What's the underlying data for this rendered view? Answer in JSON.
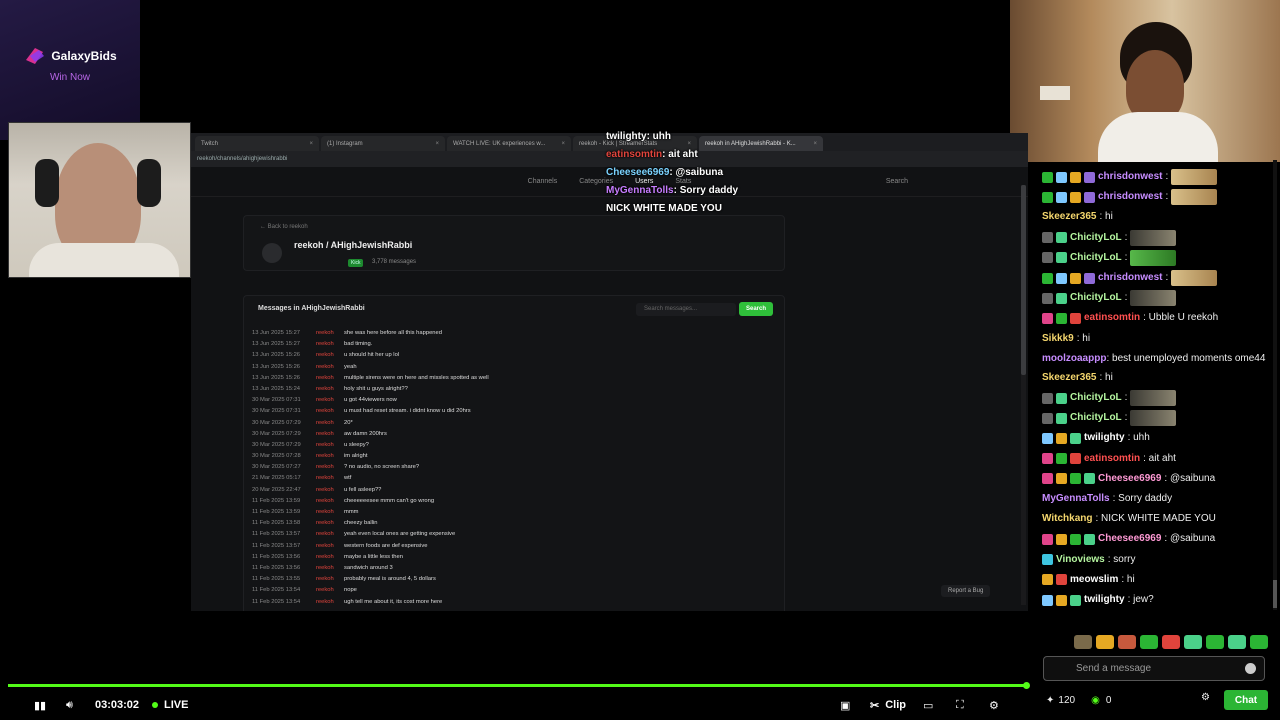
{
  "sponsor": {
    "name": "GalaxyBids",
    "tagline": "Win Now"
  },
  "browser": {
    "tabs": [
      {
        "label": "Twitch"
      },
      {
        "label": "(1) Instagram"
      },
      {
        "label": "WATCH LIVE: UK experiences w..."
      },
      {
        "label": "reekoh - Kick | StreamerStats"
      },
      {
        "label": "reekoh in AHighJewishRabbi - K..."
      }
    ],
    "url": "reekoh/channels/ahighjewishrabbi",
    "nav": [
      "Channels",
      "Categories",
      "Users",
      "Stats"
    ],
    "nav_search": "Search",
    "back_link": "← Back to reekoh",
    "profile": {
      "name": "reekoh  /  AHighJewishRabbi",
      "platform": "Kick",
      "messages": "3,778 messages",
      "view_channel": "View channel"
    },
    "panel_title": "Messages in AHighJewishRabbi",
    "search_placeholder": "Search messages...",
    "search_button": "Search",
    "messages": [
      {
        "date": "13 Jun 2025 15:27",
        "user": "reekoh",
        "text": "she was here before all this happened"
      },
      {
        "date": "13 Jun 2025 15:27",
        "user": "reekoh",
        "text": "bad timing."
      },
      {
        "date": "13 Jun 2025 15:26",
        "user": "reekoh",
        "text": "u should hit her up lol"
      },
      {
        "date": "13 Jun 2025 15:26",
        "user": "reekoh",
        "text": "yeah"
      },
      {
        "date": "13 Jun 2025 15:26",
        "user": "reekoh",
        "text": "multiple sirens were on here and missles spotted as well"
      },
      {
        "date": "13 Jun 2025 15:24",
        "user": "reekoh",
        "text": "holy shit u guys alright??"
      },
      {
        "date": "30 Mar 2025 07:31",
        "user": "reekoh",
        "text": "u got 44viewers now"
      },
      {
        "date": "30 Mar 2025 07:31",
        "user": "reekoh",
        "text": "u must had reset stream. i didnt know u did 20hrs"
      },
      {
        "date": "30 Mar 2025 07:29",
        "user": "reekoh",
        "text": "20*"
      },
      {
        "date": "30 Mar 2025 07:29",
        "user": "reekoh",
        "text": "aw damn 200hrs"
      },
      {
        "date": "30 Mar 2025 07:29",
        "user": "reekoh",
        "text": "u sleepy?"
      },
      {
        "date": "30 Mar 2025 07:28",
        "user": "reekoh",
        "text": "im alright"
      },
      {
        "date": "30 Mar 2025 07:27",
        "user": "reekoh",
        "text": "? no audio, no screen share?"
      },
      {
        "date": "21 Mar 2025 05:17",
        "user": "reekoh",
        "text": "wtf"
      },
      {
        "date": "20 Mar 2025 22:47",
        "user": "reekoh",
        "text": "u fell asleep??"
      },
      {
        "date": "11 Feb 2025 13:59",
        "user": "reekoh",
        "text": "cheeeeeesee mmm can't go wrong"
      },
      {
        "date": "11 Feb 2025 13:59",
        "user": "reekoh",
        "text": "mmm"
      },
      {
        "date": "11 Feb 2025 13:58",
        "user": "reekoh",
        "text": "cheezy ballin"
      },
      {
        "date": "11 Feb 2025 13:57",
        "user": "reekoh",
        "text": "yeah even local ones are getting expensive"
      },
      {
        "date": "11 Feb 2025 13:57",
        "user": "reekoh",
        "text": "western foods are def expensive"
      },
      {
        "date": "11 Feb 2025 13:56",
        "user": "reekoh",
        "text": "maybe a little less then"
      },
      {
        "date": "11 Feb 2025 13:56",
        "user": "reekoh",
        "text": "sandwich around 3"
      },
      {
        "date": "11 Feb 2025 13:55",
        "user": "reekoh",
        "text": "probably meal is around 4, 5 dollars"
      },
      {
        "date": "11 Feb 2025 13:54",
        "user": "reekoh",
        "text": "nope"
      },
      {
        "date": "11 Feb 2025 13:54",
        "user": "reekoh",
        "text": "ugh tell me about it, its cost more here"
      }
    ],
    "report_bug": "Report a Bug"
  },
  "alert": [
    {
      "user": "twilighty",
      "text": ": uhh",
      "color": "#ffffff"
    },
    {
      "user": "eatinsomtin",
      "text": ": ait aht",
      "color": "#e0443c"
    },
    {
      "user": "Cheesee6969",
      "text": ": @saibuna",
      "color": "#7bd3ff"
    },
    {
      "user": "MyGennaTolls",
      "text": ": Sorry daddy",
      "color": "#c77dff"
    },
    {
      "user": "",
      "text": "NICK WHITE MADE YOU",
      "color": "#ffffff"
    }
  ],
  "chat": [
    {
      "badges": [
        "#2bb534",
        "#7ec8ff",
        "#e5a823",
        "#8f6ad8"
      ],
      "user": "chrisdonwest",
      "color": "#c78dff",
      "text": ":",
      "emote": "doll"
    },
    {
      "badges": [
        "#2bb534",
        "#7ec8ff",
        "#e5a823",
        "#8f6ad8"
      ],
      "user": "chrisdonwest",
      "color": "#c78dff",
      "text": ":",
      "emote": "doll"
    },
    {
      "badges": [],
      "user": "Skeezer365",
      "color": "#f5d76e",
      "text": ": hi",
      "emote": ""
    },
    {
      "badges": [
        "#666666",
        "#4bd18a"
      ],
      "user": "ChicityLoL",
      "color": "#b5f5a0",
      "text": ":",
      "emote": "wide"
    },
    {
      "badges": [
        "#666666",
        "#4bd18a"
      ],
      "user": "ChicityLoL",
      "color": "#b5f5a0",
      "text": ":",
      "emote": "small"
    },
    {
      "badges": [
        "#2bb534",
        "#7ec8ff",
        "#e5a823",
        "#8f6ad8"
      ],
      "user": "chrisdonwest",
      "color": "#c78dff",
      "text": ":",
      "emote": "doll"
    },
    {
      "badges": [
        "#666666",
        "#4bd18a"
      ],
      "user": "ChicityLoL",
      "color": "#b5f5a0",
      "text": ":",
      "emote": "wide"
    },
    {
      "badges": [
        "#e0448a",
        "#2bb534",
        "#e0443c"
      ],
      "user": "eatinsomtin",
      "color": "#ff5050",
      "text": ": Ubble U reekoh",
      "emote": ""
    },
    {
      "badges": [],
      "user": "Sikkk9",
      "color": "#f5d76e",
      "text": ": hi",
      "emote": ""
    },
    {
      "badges": [],
      "user": "moolzoaappp",
      "color": "#c78dff",
      "text": ": best unemployed moments ome44",
      "emote": "",
      "wrap": true
    },
    {
      "badges": [],
      "user": "Skeezer365",
      "color": "#f5d76e",
      "text": ": hi",
      "emote": ""
    },
    {
      "badges": [
        "#666666",
        "#4bd18a"
      ],
      "user": "ChicityLoL",
      "color": "#b5f5a0",
      "text": ":",
      "emote": "wide"
    },
    {
      "badges": [
        "#666666",
        "#4bd18a"
      ],
      "user": "ChicityLoL",
      "color": "#b5f5a0",
      "text": ":",
      "emote": "wide"
    },
    {
      "badges": [
        "#7ec8ff",
        "#e5a823",
        "#4bd18a"
      ],
      "user": "twilighty",
      "color": "#ffffff",
      "text": ": uhh",
      "emote": ""
    },
    {
      "badges": [
        "#e0448a",
        "#2bb534",
        "#e0443c"
      ],
      "user": "eatinsomtin",
      "color": "#ff5050",
      "text": ": ait aht",
      "emote": ""
    },
    {
      "badges": [
        "#e0448a",
        "#e5a823",
        "#2bb534",
        "#4bd18a"
      ],
      "user": "Cheesee6969",
      "color": "#ff9ad5",
      "text": ": @saibuna",
      "emote": ""
    },
    {
      "badges": [],
      "user": "MyGennaTolls",
      "color": "#c78dff",
      "text": ": Sorry daddy",
      "emote": ""
    },
    {
      "badges": [],
      "user": "Witchkang",
      "color": "#f5d76e",
      "text": ": NICK WHITE MADE YOU",
      "emote": ""
    },
    {
      "badges": [
        "#e0448a",
        "#e5a823",
        "#2bb534",
        "#4bd18a"
      ],
      "user": "Cheesee6969",
      "color": "#ff9ad5",
      "text": ": @saibuna",
      "emote": ""
    },
    {
      "badges": [
        "#3ec5e0"
      ],
      "user": "Vinoviews",
      "color": "#b5f5a0",
      "text": ": sorry",
      "emote": ""
    },
    {
      "badges": [
        "#e5a823",
        "#e0443c"
      ],
      "user": "meowslim",
      "color": "#ffffff",
      "text": ": hi",
      "emote": ""
    },
    {
      "badges": [
        "#7ec8ff",
        "#e5a823",
        "#4bd18a"
      ],
      "user": "twilighty",
      "color": "#ffffff",
      "text": ": jew?",
      "emote": ""
    }
  ],
  "chat_input_placeholder": "Send a message",
  "chat_footer": {
    "points": "120",
    "likes": "0",
    "chat_button": "Chat"
  },
  "player": {
    "time": "03:03:02",
    "live": "LIVE",
    "clip": "Clip",
    "accent": "#53fc18"
  }
}
